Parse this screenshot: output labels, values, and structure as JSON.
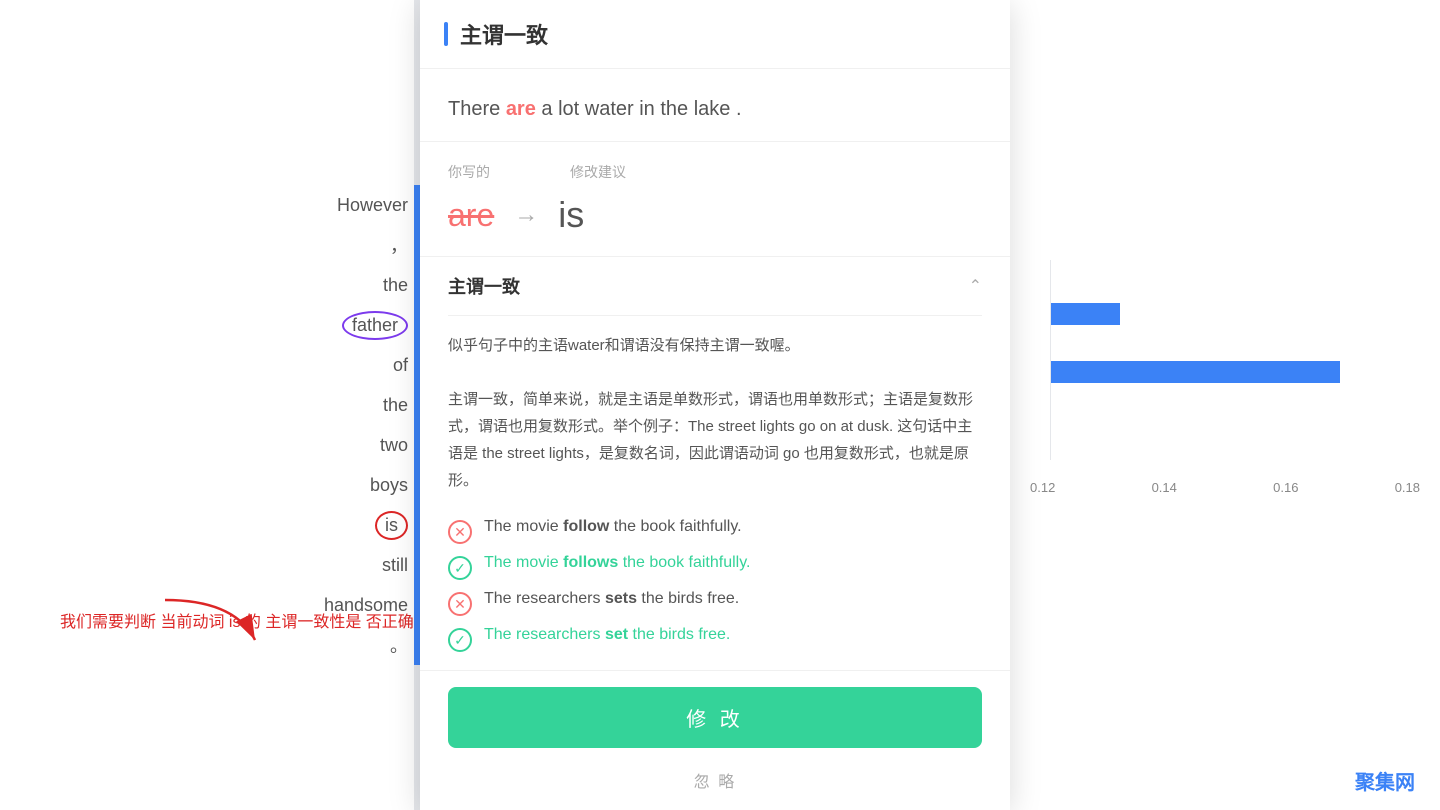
{
  "page": {
    "title": "主谓一致"
  },
  "left_panel": {
    "words": [
      {
        "text": "However",
        "bar": "blue"
      },
      {
        "text": "，",
        "bar": "blue"
      },
      {
        "text": "the",
        "bar": "blue"
      },
      {
        "text": "father",
        "circled": "purple",
        "bar": "blue"
      },
      {
        "text": "of",
        "bar": "blue"
      },
      {
        "text": "the",
        "bar": "blue"
      },
      {
        "text": "two",
        "bar": "blue"
      },
      {
        "text": "boys",
        "bar": "blue"
      },
      {
        "text": "is",
        "circled": "red",
        "bar": "blue"
      },
      {
        "text": "still",
        "bar": "blue"
      },
      {
        "text": "handsome",
        "bar": "blue"
      },
      {
        "text": "。",
        "bar": "blue"
      }
    ],
    "annotation": {
      "text": "我们需要判断\n当前动词 is 的\n主谓一致性是\n否正确",
      "color": "#dc2626"
    }
  },
  "modal": {
    "title": "主谓一致",
    "sentence": "There are a lot water in the lake .",
    "error_word": "are",
    "correction": {
      "label_old": "你写的",
      "label_new": "修改建议",
      "old": "are",
      "new": "is"
    },
    "explanation": {
      "title": "主谓一致",
      "description": "似乎句子中的主语water和谓语没有保持主谓一致喔。",
      "detail": "主谓一致，简单来说，就是主语是单数形式，谓语也用单数形式；主语是复数形式，谓语也用复数形式。举个例子：The street lights go on at dusk. 这句话中主语是 the street lights，是复数名词，因此谓语动词 go 也用复数形式，也就是原形。",
      "examples": [
        {
          "type": "wrong",
          "text": "The movie ",
          "bold": "follow",
          "rest": " the book faithfully."
        },
        {
          "type": "right",
          "text": "The movie ",
          "bold": "follows",
          "rest": " the book faithfully.",
          "correct": true
        },
        {
          "type": "wrong",
          "text": "The researchers ",
          "bold": "sets",
          "rest": " the birds free."
        },
        {
          "type": "right",
          "text": "The researchers ",
          "bold": "set",
          "rest": " the birds free.",
          "correct": true
        }
      ]
    },
    "buttons": {
      "modify": "修 改",
      "ignore": "忽 略"
    }
  },
  "right_panel": {
    "bars": [
      {
        "label": "",
        "width_pct": 20
      },
      {
        "label": "",
        "width_pct": 85
      }
    ],
    "axis_labels": [
      "0.12",
      "0.14",
      "0.16",
      "0.18"
    ],
    "watermark": "聚集网"
  }
}
